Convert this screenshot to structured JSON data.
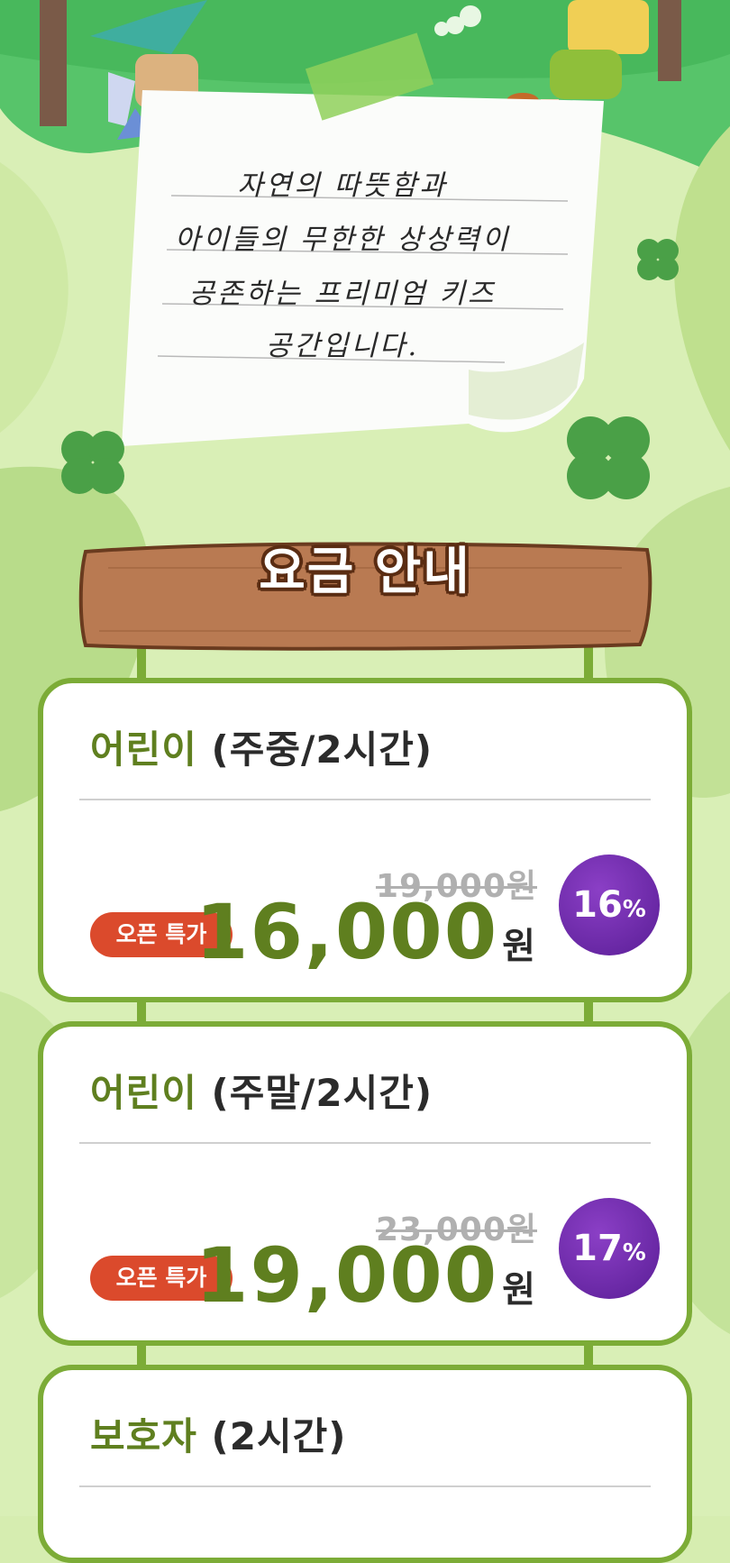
{
  "note": {
    "lines": [
      "자연의 따뜻함과",
      "아이들의 무한한 상상력이",
      "공존하는 프리미엄 키즈",
      "공간입니다."
    ]
  },
  "sign": {
    "title": "요금 안내"
  },
  "cards": [
    {
      "title_main": "어린이",
      "title_detail": " (주중/2시간)",
      "original_price": "19,000원",
      "open_label": "오픈 특가",
      "price": "16,000",
      "price_unit": "원",
      "discount": "16",
      "discount_unit": "%"
    },
    {
      "title_main": "어린이",
      "title_detail": " (주말/2시간)",
      "original_price": "23,000원",
      "open_label": "오픈 특가",
      "price": "19,000",
      "price_unit": "원",
      "discount": "17",
      "discount_unit": "%"
    },
    {
      "title_main": "보호자",
      "title_detail": " (2시간)"
    }
  ],
  "colors": {
    "card_border": "#7cac37",
    "title_green": "#5f7f1f",
    "open_badge": "#db4a2c",
    "discount_badge": "#6a2aac",
    "sign_wood": "#b97a52"
  }
}
